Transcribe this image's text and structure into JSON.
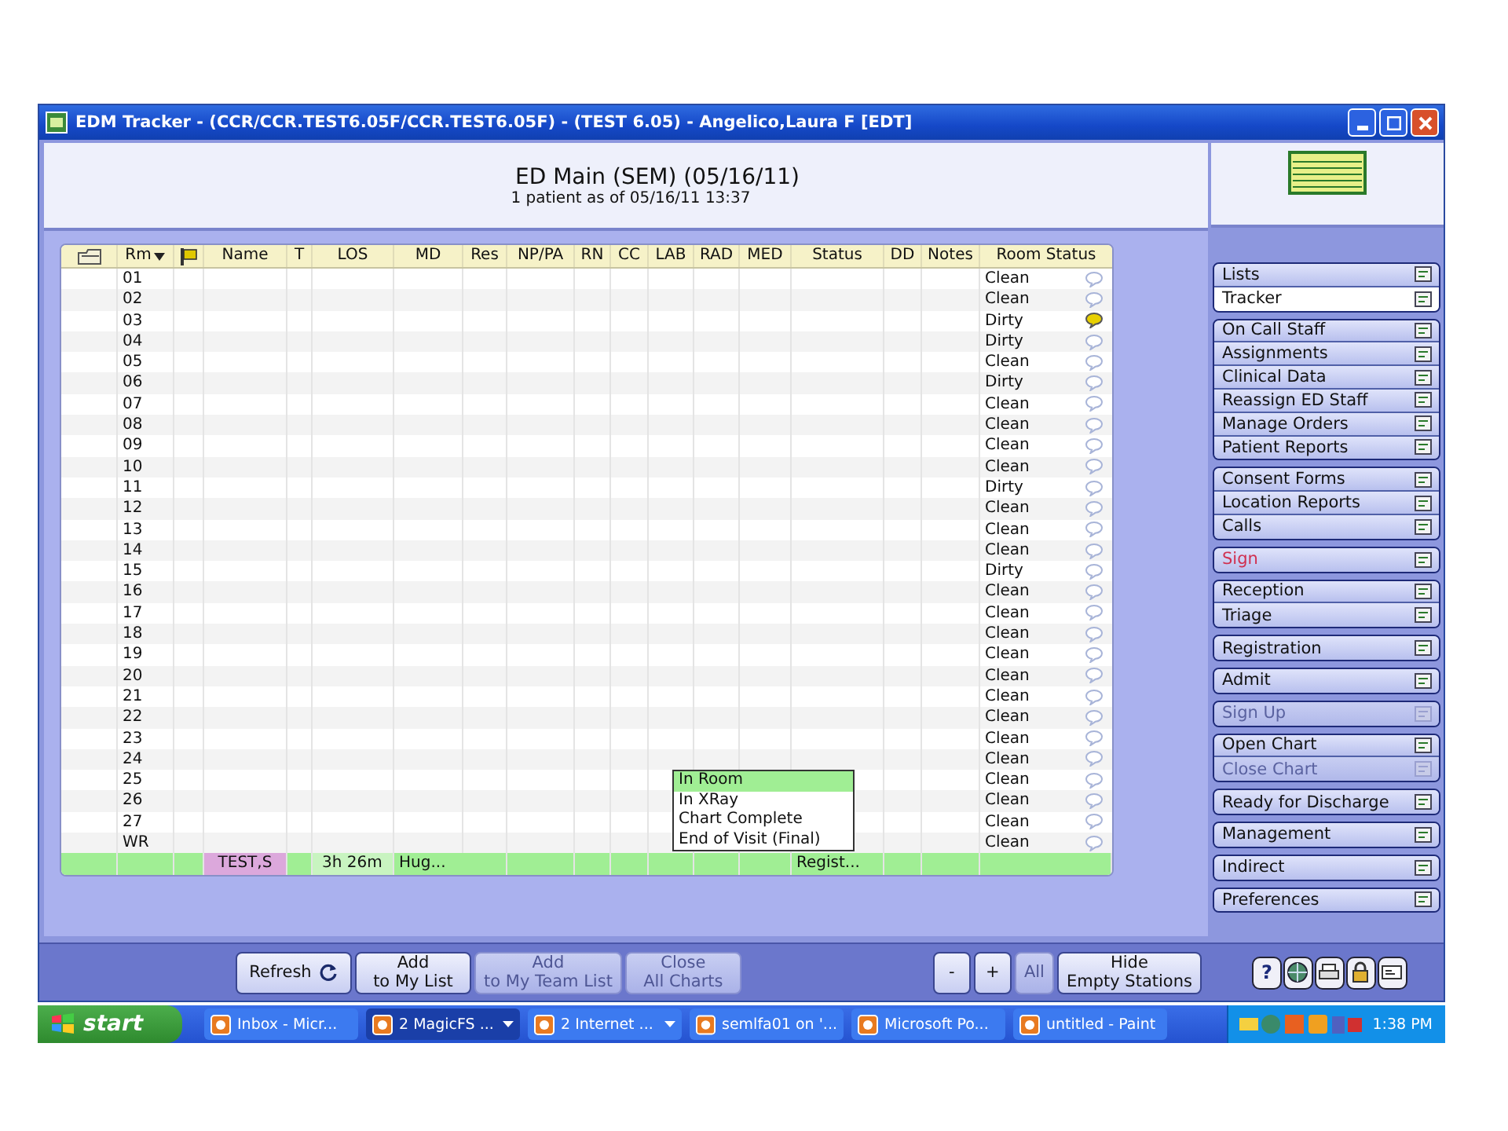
{
  "window": {
    "title": "EDM Tracker -  (CCR/CCR.TEST6.05F/CCR.TEST6.05F) - (TEST 6.05) - Angelico,Laura F [EDT]"
  },
  "header": {
    "title": "ED Main (SEM) (05/16/11)",
    "subtitle": "1 patient as of 05/16/11 13:37"
  },
  "table": {
    "columns": [
      {
        "kind": "icon"
      },
      {
        "kind": "sort",
        "label": "Rm"
      },
      {
        "kind": "flag"
      },
      {
        "kind": "text",
        "label": "Name"
      },
      {
        "kind": "text",
        "label": "T"
      },
      {
        "kind": "text",
        "label": "LOS"
      },
      {
        "kind": "text",
        "label": "MD"
      },
      {
        "kind": "text",
        "label": "Res"
      },
      {
        "kind": "text",
        "label": "NP/PA"
      },
      {
        "kind": "text",
        "label": "RN"
      },
      {
        "kind": "text",
        "label": "CC"
      },
      {
        "kind": "text",
        "label": "LAB"
      },
      {
        "kind": "text",
        "label": "RAD"
      },
      {
        "kind": "text",
        "label": "MED"
      },
      {
        "kind": "text",
        "label": "Status"
      },
      {
        "kind": "text",
        "label": "DD"
      },
      {
        "kind": "text",
        "label": "Notes"
      },
      {
        "kind": "text",
        "label": "Room Status"
      }
    ],
    "rows": [
      {
        "room": "01",
        "room_status": "Clean",
        "note_alert": false
      },
      {
        "room": "02",
        "room_status": "Clean",
        "note_alert": false
      },
      {
        "room": "03",
        "room_status": "Dirty",
        "note_alert": true
      },
      {
        "room": "04",
        "room_status": "Dirty",
        "note_alert": false
      },
      {
        "room": "05",
        "room_status": "Clean",
        "note_alert": false
      },
      {
        "room": "06",
        "room_status": "Dirty",
        "note_alert": false
      },
      {
        "room": "07",
        "room_status": "Clean",
        "note_alert": false
      },
      {
        "room": "08",
        "room_status": "Clean",
        "note_alert": false
      },
      {
        "room": "09",
        "room_status": "Clean",
        "note_alert": false
      },
      {
        "room": "10",
        "room_status": "Clean",
        "note_alert": false
      },
      {
        "room": "11",
        "room_status": "Dirty",
        "note_alert": false
      },
      {
        "room": "12",
        "room_status": "Clean",
        "note_alert": false
      },
      {
        "room": "13",
        "room_status": "Clean",
        "note_alert": false
      },
      {
        "room": "14",
        "room_status": "Clean",
        "note_alert": false
      },
      {
        "room": "15",
        "room_status": "Dirty",
        "note_alert": false
      },
      {
        "room": "16",
        "room_status": "Clean",
        "note_alert": false
      },
      {
        "room": "17",
        "room_status": "Clean",
        "note_alert": false
      },
      {
        "room": "18",
        "room_status": "Clean",
        "note_alert": false
      },
      {
        "room": "19",
        "room_status": "Clean",
        "note_alert": false
      },
      {
        "room": "20",
        "room_status": "Clean",
        "note_alert": false
      },
      {
        "room": "21",
        "room_status": "Clean",
        "note_alert": false
      },
      {
        "room": "22",
        "room_status": "Clean",
        "note_alert": false
      },
      {
        "room": "23",
        "room_status": "Clean",
        "note_alert": false
      },
      {
        "room": "24",
        "room_status": "Clean",
        "note_alert": false
      },
      {
        "room": "25",
        "room_status": "Clean",
        "note_alert": false
      },
      {
        "room": "26",
        "room_status": "Clean",
        "note_alert": false
      },
      {
        "room": "27",
        "room_status": "Clean",
        "note_alert": false
      },
      {
        "room": "WR",
        "room_status": "Clean",
        "note_alert": false
      }
    ],
    "patient_row": {
      "name": "TEST,S",
      "los": "3h 26m",
      "md": "Hug...",
      "status": "Regist..."
    }
  },
  "status_menu": {
    "items": [
      {
        "label": "In Room",
        "selected": true
      },
      {
        "label": "In XRay",
        "selected": false
      },
      {
        "label": "Chart Complete",
        "selected": false
      },
      {
        "label": "End of Visit (Final)",
        "selected": false
      }
    ]
  },
  "sidebar": {
    "groups": [
      {
        "items": [
          {
            "label": "Lists",
            "selected": false,
            "disabled": false,
            "highlighted": false
          },
          {
            "label": "Tracker",
            "selected": true,
            "disabled": false,
            "highlighted": false
          }
        ]
      },
      {
        "items": [
          {
            "label": "On Call Staff",
            "selected": false,
            "disabled": false,
            "highlighted": false
          },
          {
            "label": "Assignments",
            "selected": false,
            "disabled": false,
            "highlighted": false
          },
          {
            "label": "Clinical Data",
            "selected": false,
            "disabled": false,
            "highlighted": false
          },
          {
            "label": "Reassign ED Staff",
            "selected": false,
            "disabled": false,
            "highlighted": false
          },
          {
            "label": "Manage Orders",
            "selected": false,
            "disabled": false,
            "highlighted": false
          },
          {
            "label": "Patient Reports",
            "selected": false,
            "disabled": false,
            "highlighted": false
          }
        ]
      },
      {
        "items": [
          {
            "label": "Consent Forms",
            "selected": false,
            "disabled": false,
            "highlighted": false
          },
          {
            "label": "Location Reports",
            "selected": false,
            "disabled": false,
            "highlighted": false
          },
          {
            "label": "Calls",
            "selected": false,
            "disabled": false,
            "highlighted": false
          }
        ]
      },
      {
        "items": [
          {
            "label": "Sign",
            "selected": false,
            "disabled": false,
            "highlighted": true
          }
        ]
      },
      {
        "items": [
          {
            "label": "Reception",
            "selected": false,
            "disabled": false,
            "highlighted": false
          },
          {
            "label": "Triage",
            "selected": false,
            "disabled": false,
            "highlighted": false
          }
        ]
      },
      {
        "items": [
          {
            "label": "Registration",
            "selected": false,
            "disabled": false,
            "highlighted": false
          }
        ]
      },
      {
        "items": [
          {
            "label": "Admit",
            "selected": false,
            "disabled": false,
            "highlighted": false
          }
        ]
      },
      {
        "items": [
          {
            "label": "Sign Up",
            "selected": false,
            "disabled": true,
            "highlighted": false
          }
        ]
      },
      {
        "items": [
          {
            "label": "Open Chart",
            "selected": false,
            "disabled": false,
            "highlighted": false
          },
          {
            "label": "Close Chart",
            "selected": false,
            "disabled": true,
            "highlighted": false
          }
        ]
      },
      {
        "items": [
          {
            "label": "Ready for Discharge",
            "selected": false,
            "disabled": false,
            "highlighted": false
          }
        ]
      },
      {
        "items": [
          {
            "label": "Management",
            "selected": false,
            "disabled": false,
            "highlighted": false
          }
        ]
      },
      {
        "items": [
          {
            "label": "Indirect",
            "selected": false,
            "disabled": false,
            "highlighted": false
          }
        ]
      },
      {
        "items": [
          {
            "label": "Preferences",
            "selected": false,
            "disabled": false,
            "highlighted": false
          }
        ]
      }
    ]
  },
  "toolbar": {
    "buttons": [
      {
        "kind": "refresh",
        "lines": [
          "Refresh"
        ],
        "disabled": false
      },
      {
        "kind": "text",
        "lines": [
          "Add",
          "to My List"
        ],
        "disabled": false
      },
      {
        "kind": "text",
        "lines": [
          "Add",
          "to My Team List"
        ],
        "disabled": true
      },
      {
        "kind": "text",
        "lines": [
          "Close",
          "All Charts"
        ],
        "disabled": true
      }
    ],
    "zoom_buttons": [
      {
        "lines": [
          "-"
        ],
        "disabled": false
      },
      {
        "lines": [
          "+"
        ],
        "disabled": false
      },
      {
        "lines": [
          "All"
        ],
        "disabled": true
      },
      {
        "lines": [
          "Hide",
          "Empty Stations"
        ],
        "disabled": false
      }
    ],
    "help_label": "?"
  },
  "taskbar": {
    "start": "start",
    "tasks": [
      {
        "label": "Inbox - Micr...",
        "active": false,
        "grouped": false
      },
      {
        "label": "2 MagicFS ...",
        "active": true,
        "grouped": true
      },
      {
        "label": "2 Internet ...",
        "active": false,
        "grouped": true
      },
      {
        "label": "semlfa01 on '...",
        "active": false,
        "grouped": false
      },
      {
        "label": "Microsoft Po...",
        "active": false,
        "grouped": false
      },
      {
        "label": "untitled - Paint",
        "active": false,
        "grouped": false
      }
    ],
    "clock": "1:38 PM"
  }
}
